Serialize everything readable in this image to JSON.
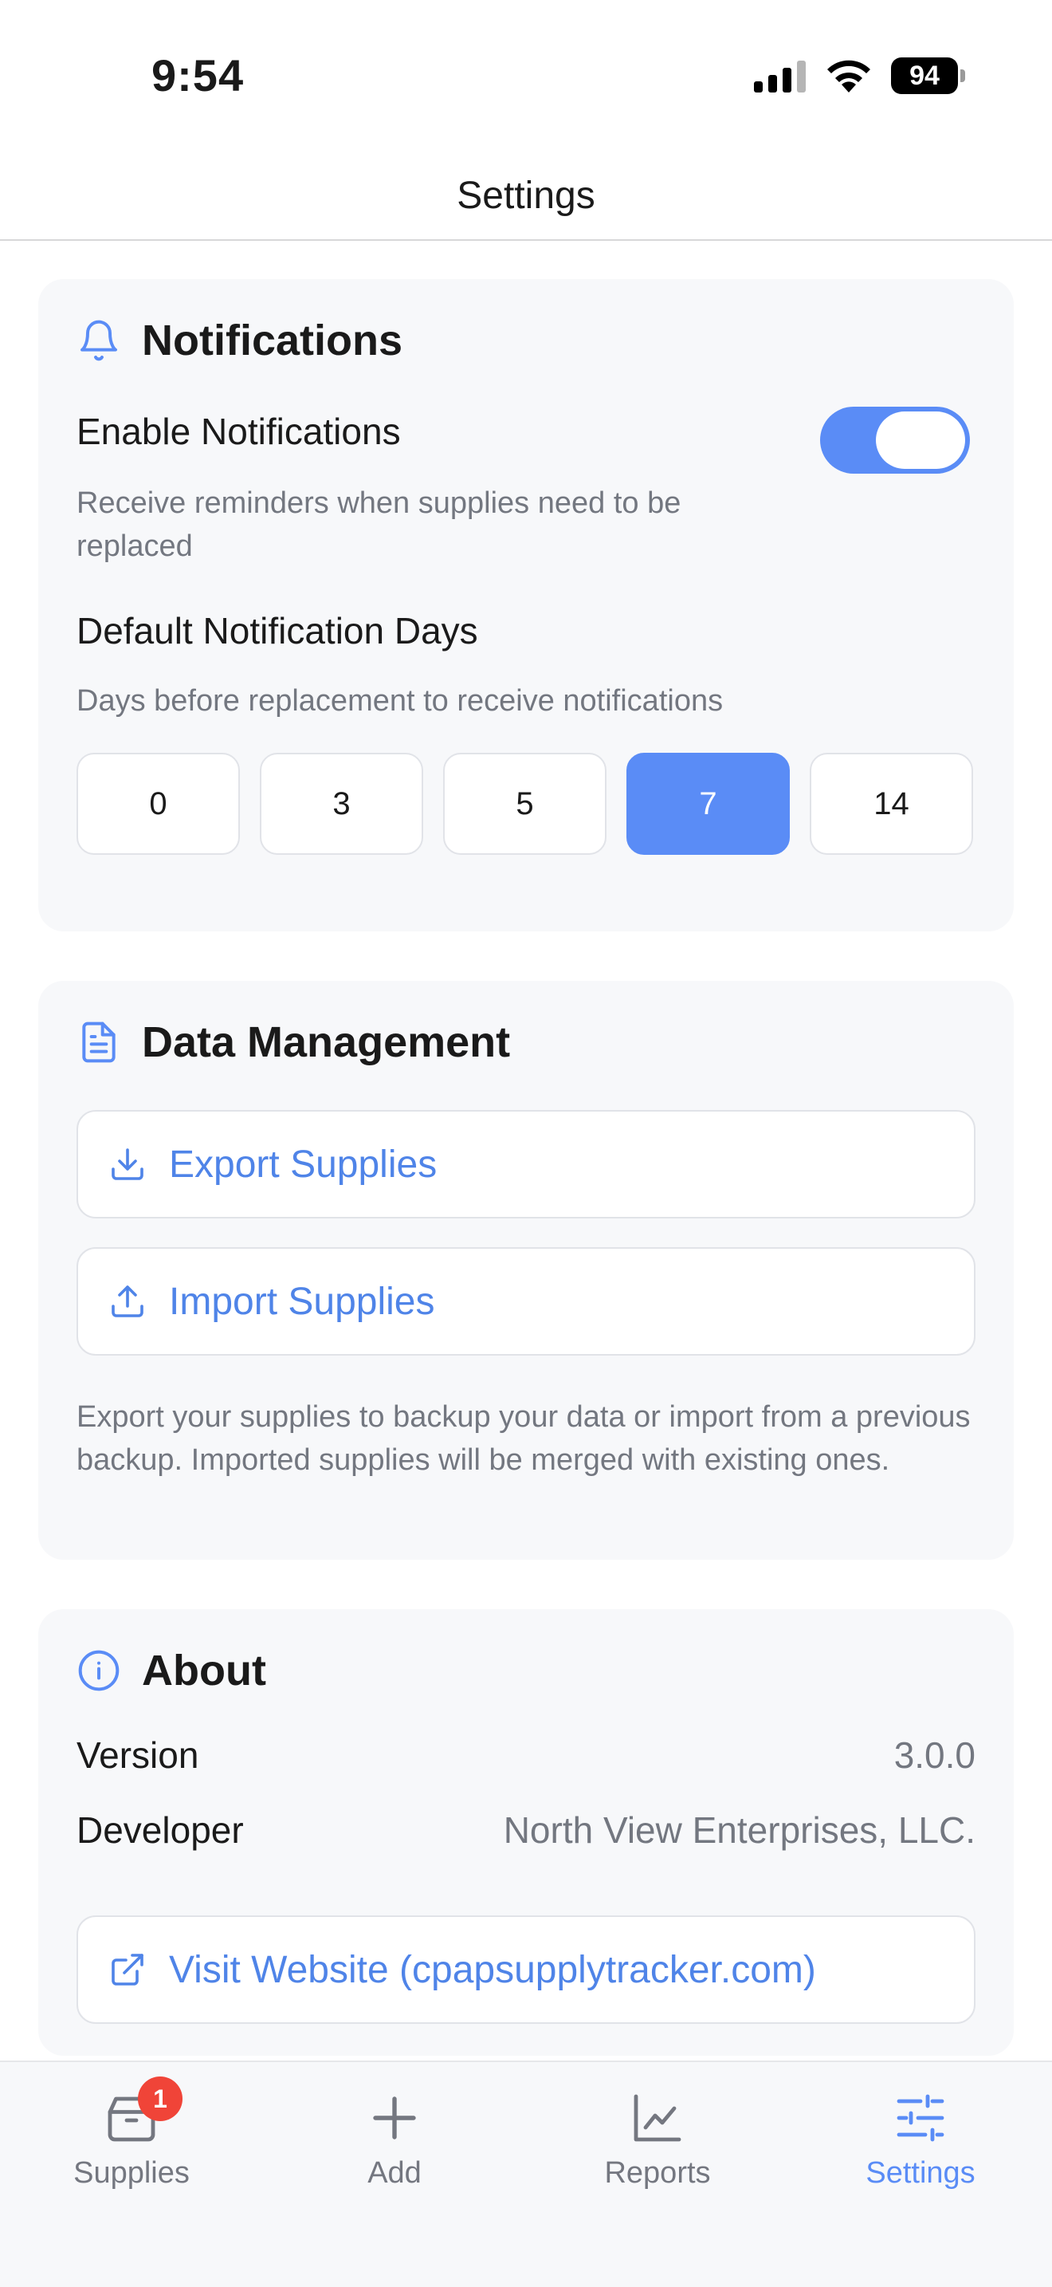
{
  "status_bar": {
    "time": "9:54",
    "battery": "94",
    "icons": [
      "cellular-signal-icon",
      "wifi-icon",
      "battery-icon"
    ]
  },
  "header": {
    "title": "Settings"
  },
  "notifications": {
    "title": "Notifications",
    "icon": "bell-icon",
    "enable_label": "Enable Notifications",
    "enable_description": "Receive reminders when supplies need to be replaced",
    "enabled": true,
    "default_days_label": "Default Notification Days",
    "default_days_description": "Days before replacement to receive notifications",
    "day_options": [
      "0",
      "3",
      "5",
      "7",
      "14"
    ],
    "selected_day": "7"
  },
  "data_management": {
    "title": "Data Management",
    "icon": "document-icon",
    "export_label": "Export Supplies",
    "import_label": "Import Supplies",
    "description": "Export your supplies to backup your data or import from a previous backup. Imported supplies will be merged with existing ones."
  },
  "about": {
    "title": "About",
    "icon": "info-icon",
    "version_label": "Version",
    "version_value": "3.0.0",
    "developer_label": "Developer",
    "developer_value": "North View Enterprises, LLC.",
    "website_label": "Visit Website (cpapsupplytracker.com)"
  },
  "tabbar": {
    "tabs": [
      {
        "label": "Supplies",
        "icon": "box-icon",
        "badge": "1"
      },
      {
        "label": "Add",
        "icon": "plus-icon"
      },
      {
        "label": "Reports",
        "icon": "chart-icon"
      },
      {
        "label": "Settings",
        "icon": "sliders-icon",
        "active": true
      }
    ]
  },
  "colors": {
    "accent": "#5a8cf6",
    "link": "#4f84e8",
    "badge": "#f04438",
    "card_bg": "#f7f8fa",
    "muted_text": "#737780"
  }
}
